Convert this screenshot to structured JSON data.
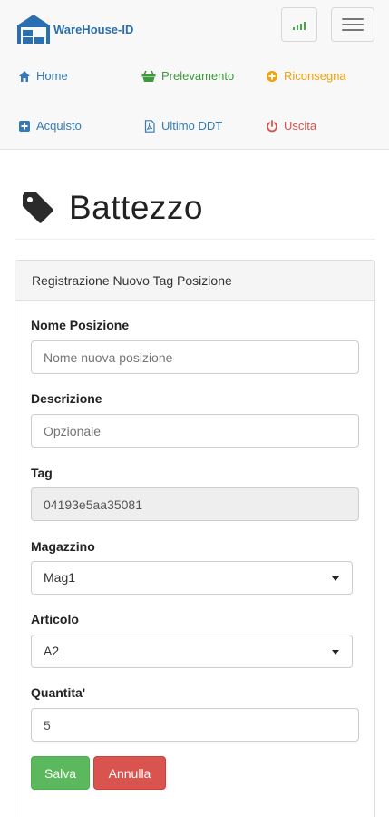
{
  "brand": {
    "name": "WareHouse-ID"
  },
  "nav": {
    "home": "Home",
    "prelevamento": "Prelevamento",
    "riconsegna": "Riconsegna",
    "acquisto": "Acquisto",
    "ultimo_ddt": "Ultimo DDT",
    "uscita": "Uscita"
  },
  "page": {
    "title": "Battezzo"
  },
  "panel": {
    "heading": "Registrazione Nuovo Tag Posizione"
  },
  "form": {
    "nome_posizione": {
      "label": "Nome Posizione",
      "placeholder": "Nome nuova posizione"
    },
    "descrizione": {
      "label": "Descrizione",
      "placeholder": "Opzionale"
    },
    "tag": {
      "label": "Tag",
      "value": "04193e5aa35081"
    },
    "magazzino": {
      "label": "Magazzino",
      "selected": "Mag1"
    },
    "articolo": {
      "label": "Articolo",
      "selected": "A2"
    },
    "quantita": {
      "label": "Quantita'",
      "value": "5"
    }
  },
  "buttons": {
    "save": "Salva",
    "cancel": "Annulla"
  },
  "colors": {
    "brand": "#2a6fb0",
    "home": "#337ab7",
    "prelevamento": "#3c9a3c",
    "riconsegna": "#f0a30a",
    "acquisto": "#337ab7",
    "ultimo_ddt": "#337ab7",
    "uscita": "#d9534f",
    "save": "#5cb85c",
    "cancel": "#d9534f"
  }
}
